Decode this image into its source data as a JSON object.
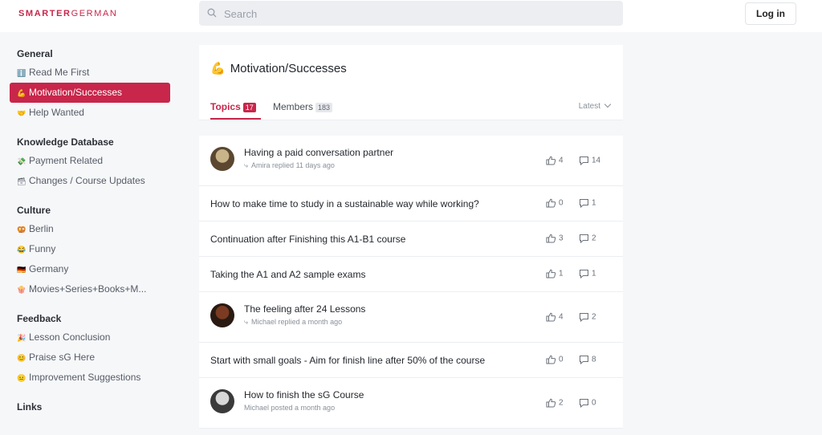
{
  "header": {
    "logo_part1": "SMARTER",
    "logo_part2": "GERMAN",
    "search_placeholder": "Search",
    "login_label": "Log in"
  },
  "sidebar": {
    "sections": [
      {
        "title": "General",
        "items": [
          {
            "emoji": "ℹ️",
            "label": "Read Me First"
          },
          {
            "emoji": "💪",
            "label": "Motivation/Successes",
            "active": true
          },
          {
            "emoji": "🤝",
            "label": "Help Wanted"
          }
        ]
      },
      {
        "title": "Knowledge Database",
        "items": [
          {
            "emoji": "💸",
            "label": "Payment Related"
          },
          {
            "emoji": "🗃",
            "label": "Changes / Course Updates"
          }
        ]
      },
      {
        "title": "Culture",
        "items": [
          {
            "emoji": "🥨",
            "label": "Berlin"
          },
          {
            "emoji": "😂",
            "label": "Funny"
          },
          {
            "emoji": "🇩🇪",
            "label": "Germany"
          },
          {
            "emoji": "🍿",
            "label": "Movies+Series+Books+M..."
          }
        ]
      },
      {
        "title": "Feedback",
        "items": [
          {
            "emoji": "🎉",
            "label": "Lesson Conclusion"
          },
          {
            "emoji": "😊",
            "label": "Praise sG Here"
          },
          {
            "emoji": "😐",
            "label": "Improvement Suggestions"
          }
        ]
      },
      {
        "title": "Links",
        "items": []
      }
    ]
  },
  "channel": {
    "emoji": "💪",
    "title": "Motivation/Successes",
    "tab_topics": "Topics",
    "topics_count": "17",
    "tab_members": "Members",
    "members_count": "183",
    "sort_label": "Latest"
  },
  "topics": [
    {
      "title": "Having a paid conversation partner",
      "meta": "Amira replied 11 days ago",
      "reply": true,
      "avatar": "avatar-1",
      "likes": "4",
      "comments": "14"
    },
    {
      "title": "How to make time to study in a sustainable way while working?",
      "likes": "0",
      "comments": "1"
    },
    {
      "title": "Continuation after Finishing this A1-B1 course",
      "likes": "3",
      "comments": "2"
    },
    {
      "title": "Taking the A1 and A2 sample exams",
      "likes": "1",
      "comments": "1"
    },
    {
      "title": "The feeling after 24 Lessons",
      "meta": "Michael replied a month ago",
      "reply": true,
      "avatar": "avatar-2",
      "likes": "4",
      "comments": "2"
    },
    {
      "title": "Start with small goals - Aim for finish line after 50% of the course",
      "likes": "0",
      "comments": "8"
    },
    {
      "title": "How to finish the sG Course",
      "meta": "Michael posted a month ago",
      "reply": false,
      "avatar": "avatar-3",
      "likes": "2",
      "comments": "0"
    }
  ],
  "colors": {
    "accent": "#c8264a",
    "background": "#f6f7f9"
  }
}
